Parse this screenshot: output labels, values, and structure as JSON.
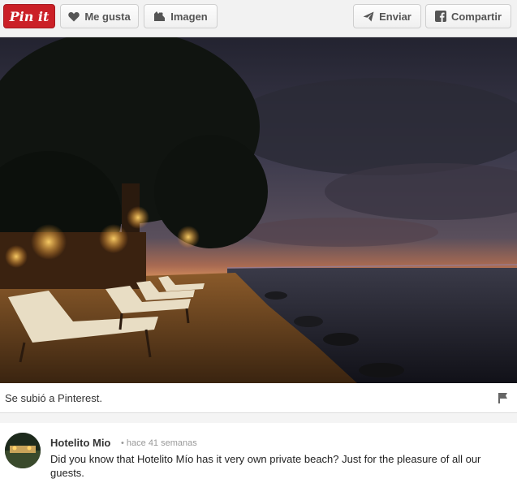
{
  "toolbar": {
    "pinit_label": "Pin it",
    "like_label": "Me gusta",
    "image_label": "Imagen",
    "send_label": "Enviar",
    "share_label": "Compartir"
  },
  "caption": {
    "text": "Se subió a Pinterest."
  },
  "comment": {
    "author": "Hotelito Mio",
    "time": "• hace 41 semanas",
    "text": "Did you know that Hotelito Mío has it very own private beach? Just for the pleasure of all our guests."
  },
  "colors": {
    "pin_red": "#cb2027",
    "toolbar_bg": "#f2f2f2"
  },
  "icons": [
    "heart-icon",
    "image-icon",
    "send-icon",
    "facebook-icon",
    "flag-icon"
  ]
}
